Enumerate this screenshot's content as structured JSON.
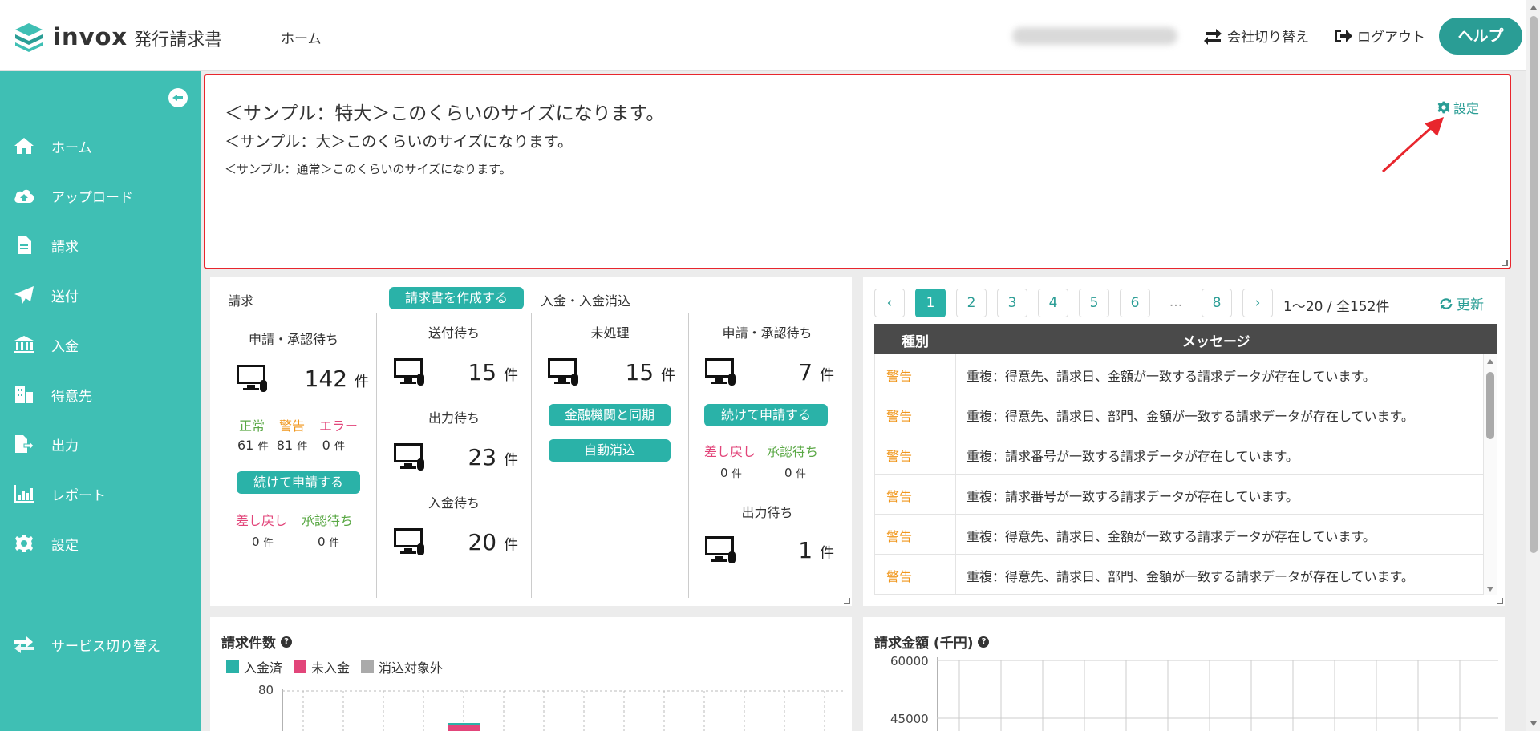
{
  "header": {
    "logo_text": "invox",
    "logo_sub": "発行請求書",
    "home_link": "ホーム",
    "switch_company": "会社切り替え",
    "logout": "ログアウト",
    "help": "ヘルプ"
  },
  "sidebar": {
    "items": [
      {
        "label": "ホーム",
        "icon": "home-icon"
      },
      {
        "label": "アップロード",
        "icon": "cloud-upload-icon"
      },
      {
        "label": "請求",
        "icon": "document-icon"
      },
      {
        "label": "送付",
        "icon": "paper-plane-icon"
      },
      {
        "label": "入金",
        "icon": "bank-icon"
      },
      {
        "label": "得意先",
        "icon": "building-icon"
      },
      {
        "label": "出力",
        "icon": "file-export-icon"
      },
      {
        "label": "レポート",
        "icon": "chart-icon"
      },
      {
        "label": "設定",
        "icon": "gear-icon"
      }
    ],
    "service_switch": "サービス切り替え"
  },
  "sample": {
    "xl": "＜サンプル：特大＞このくらいのサイズになります。",
    "l": "＜サンプル：大＞このくらいのサイズになります。",
    "n": "＜サンプル：通常＞このくらいのサイズになります。",
    "settings": "設定"
  },
  "status": {
    "billing_title": "請求",
    "create_button": "請求書を作成する",
    "payment_title": "入金・入金消込",
    "col1": {
      "label": "申請・承認待ち",
      "count": "142",
      "unit": "件",
      "normal": "正常",
      "warning": "警告",
      "error": "エラー",
      "normal_count": "61",
      "warning_count": "81",
      "error_count": "0",
      "continue_button": "続けて申請する",
      "returned": "差し戻し",
      "approval_wait": "承認待ち",
      "returned_count": "0",
      "approval_count": "0"
    },
    "col2": {
      "send_label": "送付待ち",
      "send_count": "15",
      "output_label": "出力待ち",
      "output_count": "23",
      "payment_label": "入金待ち",
      "payment_count": "20"
    },
    "col3": {
      "label": "未処理",
      "count": "15",
      "sync_button": "金融機関と同期",
      "auto_button": "自動消込"
    },
    "col4": {
      "label": "申請・承認待ち",
      "count": "7",
      "continue_button": "続けて申請する",
      "returned": "差し戻し",
      "approval_wait": "承認待ち",
      "returned_count": "0",
      "approval_count": "0",
      "output_label": "出力待ち",
      "output_count": "1"
    },
    "unit": "件"
  },
  "messages": {
    "pages": [
      "1",
      "2",
      "3",
      "4",
      "5",
      "6",
      "...",
      "8"
    ],
    "active_page": "1",
    "range": "1〜20 / 全152件",
    "refresh": "更新",
    "col_type": "種別",
    "col_message": "メッセージ",
    "rows": [
      {
        "type": "警告",
        "message": "重複：得意先、請求日、金額が一致する請求データが存在しています。"
      },
      {
        "type": "警告",
        "message": "重複：得意先、請求日、部門、金額が一致する請求データが存在しています。"
      },
      {
        "type": "警告",
        "message": "重複：請求番号が一致する請求データが存在しています。"
      },
      {
        "type": "警告",
        "message": "重複：請求番号が一致する請求データが存在しています。"
      },
      {
        "type": "警告",
        "message": "重複：得意先、請求日、金額が一致する請求データが存在しています。"
      },
      {
        "type": "警告",
        "message": "重複：得意先、請求日、部門、金額が一致する請求データが存在しています。"
      }
    ]
  },
  "chart1": {
    "title": "請求件数",
    "legend": [
      {
        "label": "入金済",
        "color": "#2ab2a8"
      },
      {
        "label": "未入金",
        "color": "#e2457a"
      },
      {
        "label": "消込対象外",
        "color": "#aaaaaa"
      }
    ],
    "ytick": "80"
  },
  "chart2": {
    "title": "請求金額 (千円)",
    "ytick_top": "60000",
    "ytick_mid": "45000"
  },
  "colors": {
    "accent": "#2ab2a8",
    "sidebar": "#3fbfb4",
    "warning": "#f0961b",
    "error": "#e2457a",
    "ok": "#5aa845"
  }
}
